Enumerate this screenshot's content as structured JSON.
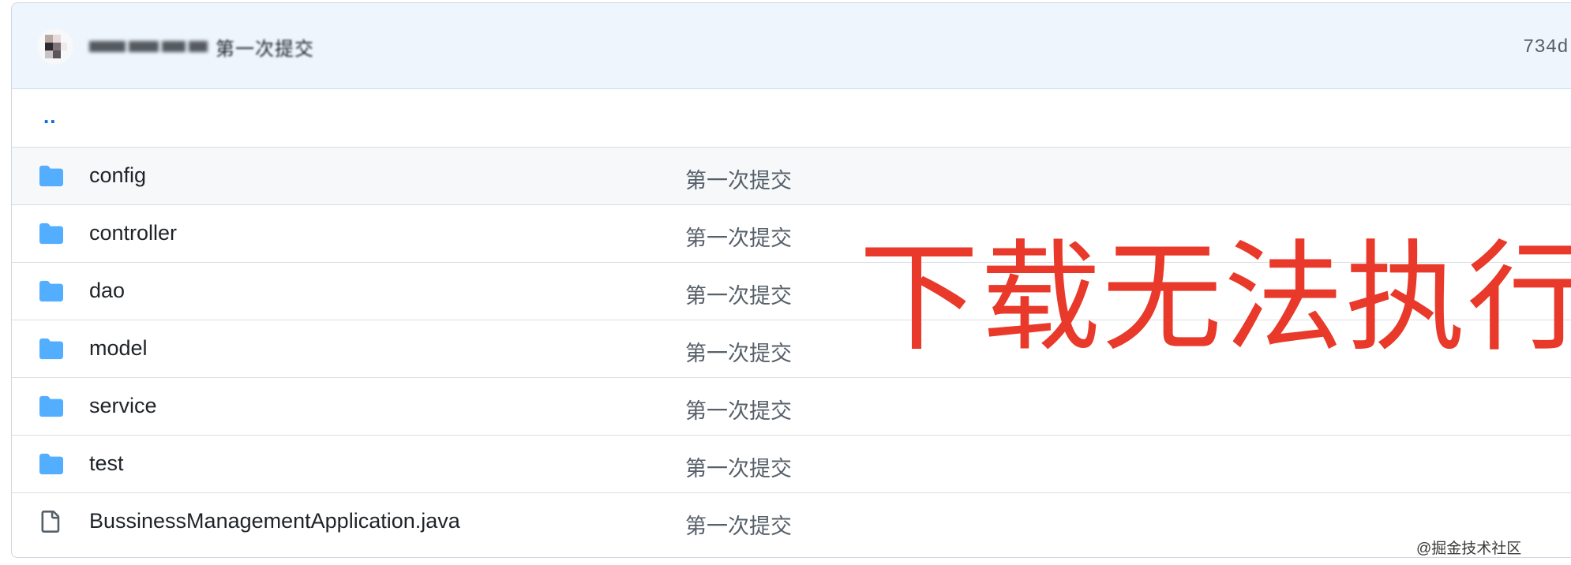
{
  "commit": {
    "author_blurred": "",
    "message_tail": "第一次提交",
    "hash": "734d"
  },
  "up_link": "..",
  "rows": [
    {
      "type": "folder",
      "name": "config",
      "message": "第一次提交"
    },
    {
      "type": "folder",
      "name": "controller",
      "message": "第一次提交"
    },
    {
      "type": "folder",
      "name": "dao",
      "message": "第一次提交"
    },
    {
      "type": "folder",
      "name": "model",
      "message": "第一次提交"
    },
    {
      "type": "folder",
      "name": "service",
      "message": "第一次提交"
    },
    {
      "type": "folder",
      "name": "test",
      "message": "第一次提交"
    },
    {
      "type": "file",
      "name": "BussinessManagementApplication.java",
      "message": "第一次提交"
    }
  ],
  "overlay": {
    "text": "下载无法执行",
    "color": "#e8392a"
  },
  "watermark": "@掘金技术社区",
  "colors": {
    "folder_icon": "#54aeff",
    "link": "#0969da",
    "commit_bar": "#eef5fd",
    "border": "#d0d7de"
  },
  "icons": {
    "folder": "folder-icon",
    "file": "file-icon"
  }
}
